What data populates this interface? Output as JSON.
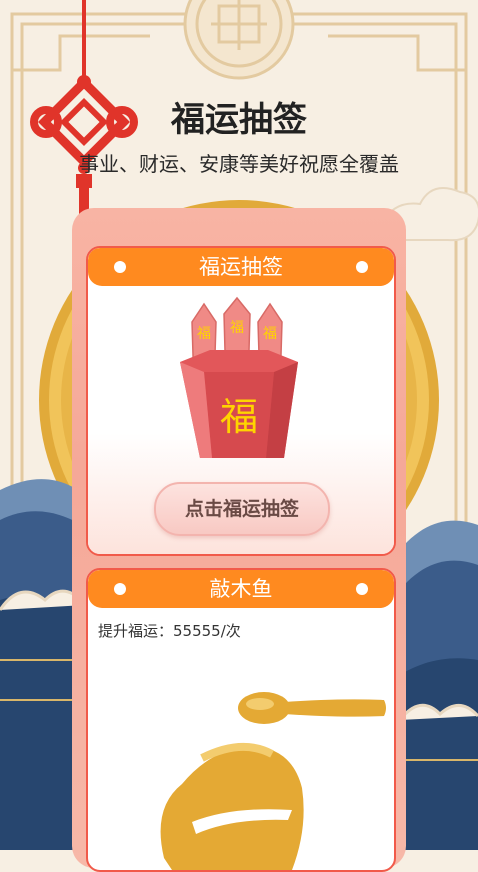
{
  "header": {
    "title": "福运抽签",
    "subtitle": "事业、财运、安康等美好祝愿全覆盖"
  },
  "fortune_card": {
    "title": "福运抽签",
    "stick_char": "福",
    "bucket_char": "福",
    "draw_button_label": "点击福运抽签"
  },
  "woodfish_card": {
    "title": "敲木鱼",
    "stat_text": "提升福运：55555/次"
  },
  "colors": {
    "accent_orange": "#ff8a1f",
    "card_border": "#f15a4a",
    "knot_red": "#e0342a",
    "gold": "#e1aa3a"
  }
}
